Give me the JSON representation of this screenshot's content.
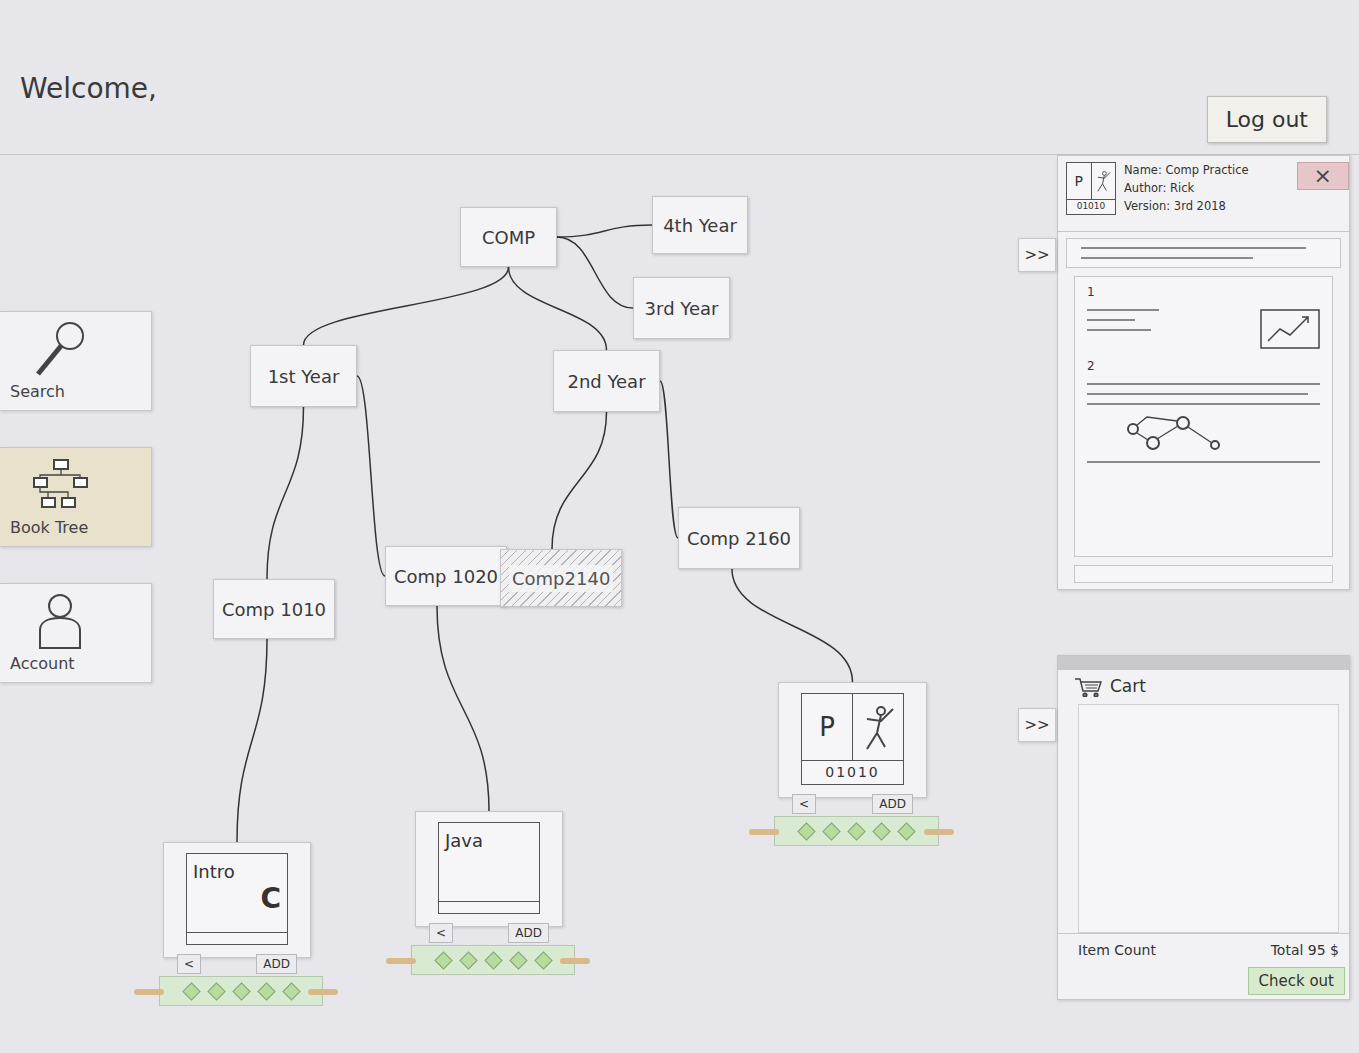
{
  "header": {
    "greeting": "Welcome,",
    "logout": "Log out"
  },
  "sidebar": {
    "items": [
      {
        "label": "Search",
        "selected": false
      },
      {
        "label": "Book Tree",
        "selected": true
      },
      {
        "label": "Account",
        "selected": false
      }
    ]
  },
  "tree": {
    "label": "COMP",
    "disabled": false,
    "children": [
      {
        "label": "1st Year",
        "disabled": false,
        "children": [
          {
            "label": "Comp 1010",
            "disabled": false,
            "book": {
              "kind": "plain",
              "cover": [
                "Intro",
                "C"
              ],
              "back": "<",
              "add": "ADD",
              "stars": 5
            }
          },
          {
            "label": "Comp 1020",
            "disabled": false,
            "book": {
              "kind": "plain",
              "cover": [
                "Java"
              ],
              "back": "<",
              "add": "ADD",
              "stars": 5
            }
          }
        ]
      },
      {
        "label": "2nd Year",
        "disabled": false,
        "children": [
          {
            "label": "Comp2140",
            "disabled": true
          },
          {
            "label": "Comp 2160",
            "disabled": false,
            "book": {
              "kind": "logo",
              "cover": [
                "P"
              ],
              "code": "01010",
              "back": "<",
              "add": "ADD",
              "stars": 5
            }
          }
        ]
      },
      {
        "label": "3rd Year",
        "disabled": false,
        "children": []
      },
      {
        "label": "4th Year",
        "disabled": false,
        "children": []
      }
    ]
  },
  "details": {
    "thumb": {
      "letter": "P",
      "code": "01010"
    },
    "name": "Name: Comp Practice",
    "author": "Author: Rick",
    "version": "Version: 3rd 2018",
    "close": "×",
    "collapse": ">>",
    "sections": [
      "1",
      "2"
    ]
  },
  "cart": {
    "title": "Cart",
    "collapse": ">>",
    "item_count": "Item Count",
    "total": "Total 95 $",
    "checkout": "Check out"
  }
}
